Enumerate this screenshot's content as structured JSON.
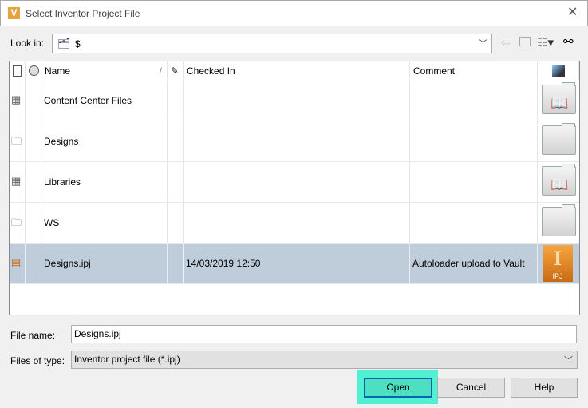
{
  "window": {
    "title": "Select Inventor Project File",
    "logo": "V",
    "close": "✕"
  },
  "lookin": {
    "label": "Look in:",
    "value": "$"
  },
  "columns": {
    "name": "Name",
    "checked_in": "Checked In",
    "comment": "Comment",
    "sort": "/"
  },
  "rows": [
    {
      "name": "Content Center Files",
      "checked_in": "",
      "comment": "",
      "type": "library"
    },
    {
      "name": "Designs",
      "checked_in": "",
      "comment": "",
      "type": "folder"
    },
    {
      "name": "Libraries",
      "checked_in": "",
      "comment": "",
      "type": "library"
    },
    {
      "name": "WS",
      "checked_in": "",
      "comment": "",
      "type": "folder"
    },
    {
      "name": "Designs.ipj",
      "checked_in": "14/03/2019 12:50",
      "comment": "Autoloader upload to Vault",
      "type": "ipj",
      "selected": true,
      "badge": "IPJ",
      "glyph": "I"
    }
  ],
  "filename": {
    "label": "File name:",
    "value": "Designs.ipj"
  },
  "filetype": {
    "label": "Files of type:",
    "value": "Inventor project file (*.ipj)"
  },
  "buttons": {
    "open": "Open",
    "cancel": "Cancel",
    "help": "Help"
  }
}
